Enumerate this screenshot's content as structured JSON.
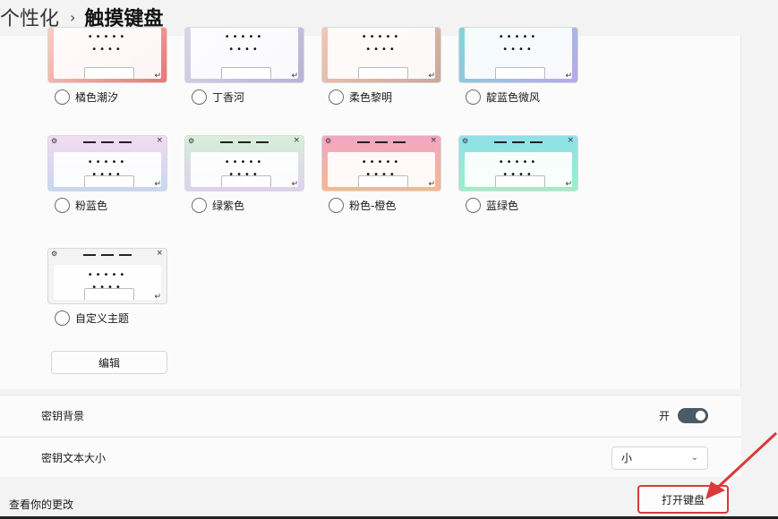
{
  "breadcrumb": {
    "parent": "个性化",
    "separator": "›",
    "current": "触摸键盘"
  },
  "themes": [
    {
      "name": "橘色潮汐",
      "bg": "linear-gradient(135deg,#f7d0c4,#e9757a)"
    },
    {
      "name": "丁香河",
      "bg": "linear-gradient(135deg,#d8d6ec,#b8b2d6)"
    },
    {
      "name": "柔色黎明",
      "bg": "linear-gradient(135deg,#f3c7b3,#c9a89c)"
    },
    {
      "name": "靛蓝色微风",
      "bg": "linear-gradient(135deg,#7fd6d6,#b9a8ea)"
    },
    {
      "name": "粉蓝色",
      "bg": "linear-gradient(180deg,#f2dcef,#c6d6f4)"
    },
    {
      "name": "绿紫色",
      "bg": "linear-gradient(180deg,#d7efd9,#ddd0f0)"
    },
    {
      "name": "粉色-橙色",
      "bg": "linear-gradient(180deg,#f2a6c5,#f7b78c)"
    },
    {
      "name": "蓝绿色",
      "bg": "linear-gradient(180deg,#8fe0ea,#9cefc8)"
    },
    {
      "name": "自定义主题",
      "bg": "#f3f3f3"
    }
  ],
  "key_symbols": {
    "gear": "⚙",
    "close": "×",
    "enter": "↵",
    "dots": "•••••",
    "dots2": "••••"
  },
  "edit_button": "编辑",
  "key_background": {
    "label": "密钥背景",
    "state": "开"
  },
  "key_text_size": {
    "label": "密钥文本大小",
    "value": "小",
    "chevron": "⌄"
  },
  "footer": {
    "label": "查看你的更改",
    "open_keyboard": "打开键盘"
  },
  "colors": {
    "highlight": "#d93a3a",
    "toggle_on": "#4a5a66"
  }
}
